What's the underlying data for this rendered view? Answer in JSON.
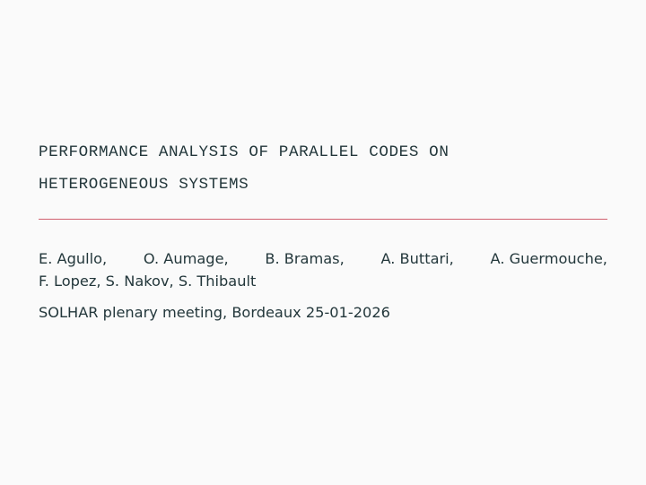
{
  "slide": {
    "title_lines": [
      "Performance analysis of parallel codes on",
      "heterogeneous systems"
    ],
    "authors_line1": [
      "E. Agullo,",
      "O. Aumage,",
      "B. Bramas,",
      "A. Buttari,",
      "A. Guermouche,"
    ],
    "authors_line2": "F. Lopez, S. Nakov, S. Thibault",
    "event": "SOLHAR plenary meeting, Bordeaux 25-01-2026"
  },
  "colors": {
    "background": "#FAFAFA",
    "text": "#23373B",
    "rule": "#D0606E"
  }
}
